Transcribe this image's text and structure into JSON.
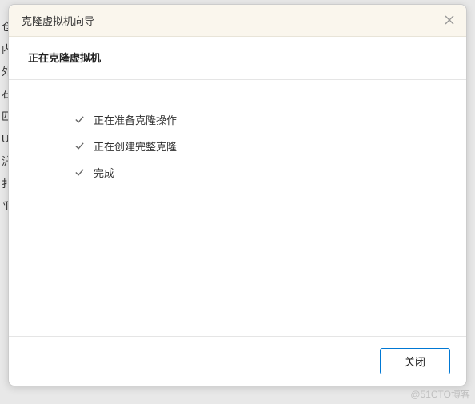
{
  "dialog": {
    "title": "克隆虚拟机向导",
    "subtitle": "正在克隆虚拟机",
    "steps": [
      {
        "label": "正在准备克隆操作"
      },
      {
        "label": "正在创建完整克隆"
      },
      {
        "label": "完成"
      }
    ],
    "close_button_label": "关闭"
  },
  "backdrop": {
    "chars": [
      "仓",
      "内",
      "外",
      "石",
      "匹",
      "U",
      "沪",
      "扌",
      "乎"
    ]
  },
  "watermark": "@51CTO博客"
}
